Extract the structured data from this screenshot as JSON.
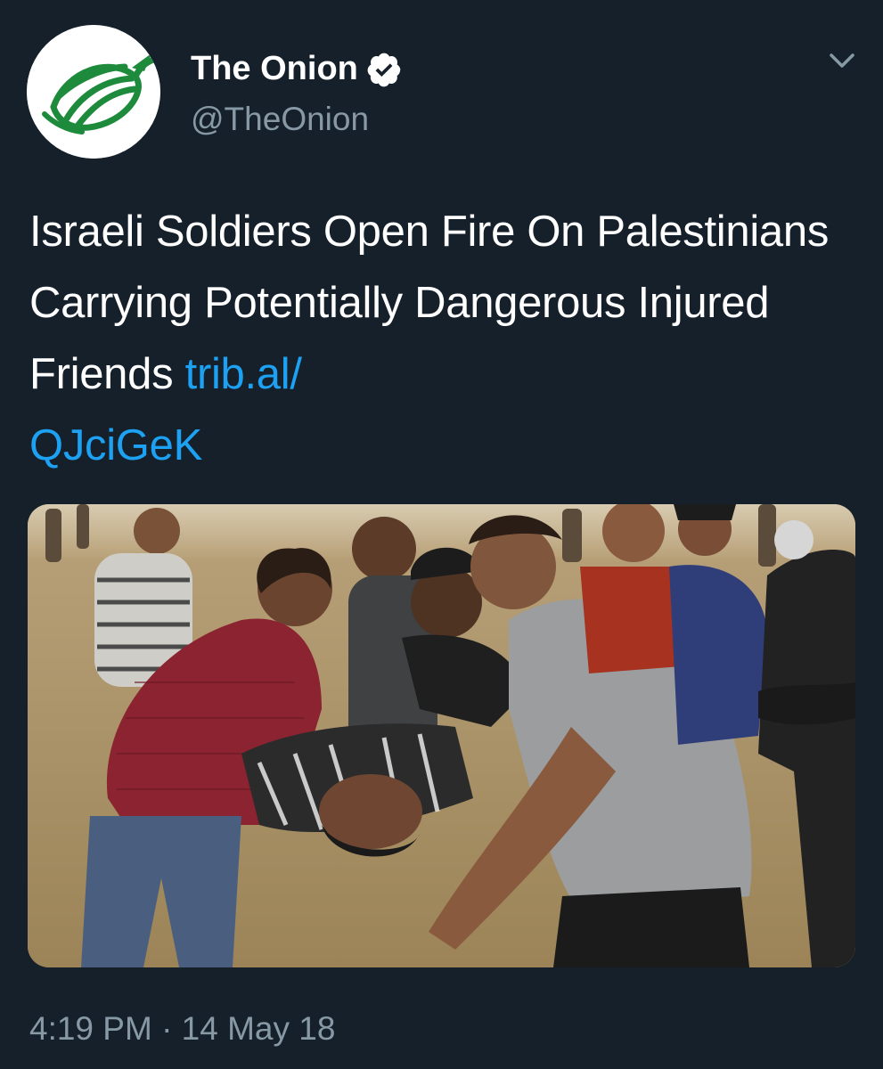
{
  "tweet": {
    "author": {
      "display_name": "The Onion",
      "handle": "@TheOnion",
      "verified": true,
      "avatar_icon": "onion-logo-icon"
    },
    "text": "Israeli Soldiers Open Fire On Palestinians Carrying Potentially Dangerous Injured Friends",
    "link": "trib.al/QJciGeK",
    "link_line1": "trib.al/",
    "link_line2": "QJciGeK",
    "timestamp": "4:19 PM · 14 May 18",
    "menu_icon": "chevron-down-icon"
  },
  "colors": {
    "background": "#15202b",
    "text": "#ffffff",
    "secondary_text": "#8899a6",
    "link": "#1da1f2",
    "brand_green": "#1e8a3c"
  }
}
